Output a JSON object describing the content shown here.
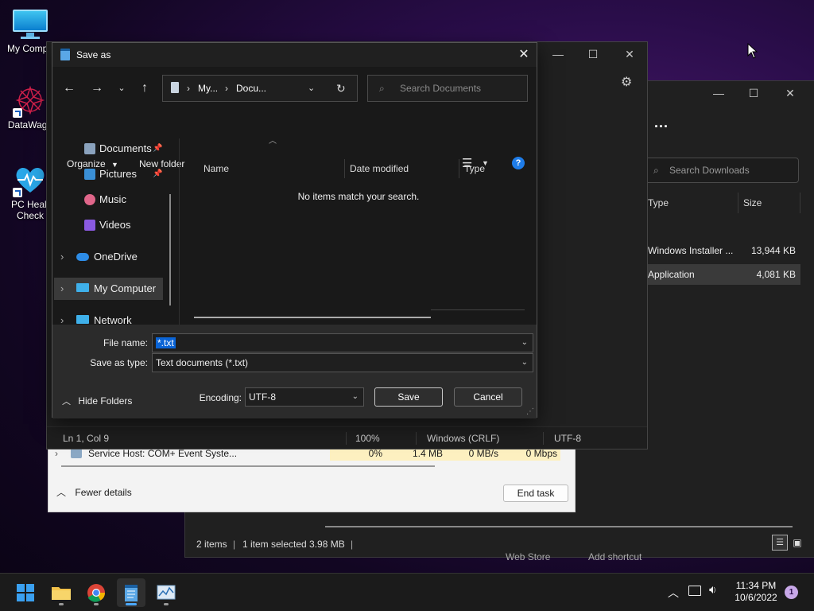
{
  "desktop": {
    "icons": [
      {
        "label": "My Compu"
      },
      {
        "label": "DataWago"
      },
      {
        "label": "PC Healt Check"
      }
    ]
  },
  "explorer": {
    "search_placeholder": "Search Downloads",
    "more": "...",
    "columns": [
      "Type",
      "Size"
    ],
    "rows": [
      {
        "type": "Windows Installer ...",
        "size": "13,944 KB"
      },
      {
        "type": "Application",
        "size": "4,081 KB"
      }
    ],
    "status": {
      "items": "2 items",
      "sep": "|",
      "selected": "1 item selected  3.98 MB"
    },
    "behind_text": [
      "Web Store",
      "Add shortcut"
    ]
  },
  "taskmgr": {
    "row_label": "Service Host: COM+ Event Syste...",
    "row_values": [
      "0%",
      "1.4 MB",
      "0 MB/s",
      "0 Mbps"
    ],
    "fewer_details": "Fewer details",
    "end_task": "End task"
  },
  "notepad": {
    "status": {
      "position": "Ln 1, Col 9",
      "zoom": "100%",
      "eol": "Windows (CRLF)",
      "encoding": "UTF-8"
    }
  },
  "saveas": {
    "title": "Save as",
    "address": {
      "part1": "My...",
      "part2": "Docu..."
    },
    "search_placeholder": "Search Documents",
    "toolbar": {
      "organize": "Organize",
      "new_folder": "New folder"
    },
    "tree": [
      {
        "label": "Documents",
        "pinned": true
      },
      {
        "label": "Pictures",
        "pinned": true
      },
      {
        "label": "Music",
        "pinned": false
      },
      {
        "label": "Videos",
        "pinned": false
      },
      {
        "label": "OneDrive"
      },
      {
        "label": "My Computer"
      },
      {
        "label": "Network"
      }
    ],
    "columns": [
      "Name",
      "Date modified",
      "Type"
    ],
    "empty_message": "No items match your search.",
    "file_name_label": "File name:",
    "file_name_value": "*.txt",
    "save_as_type_label": "Save as type:",
    "save_as_type_value": "Text documents (*.txt)",
    "hide_folders": "Hide Folders",
    "encoding_label": "Encoding:",
    "encoding_value": "UTF-8",
    "save_button": "Save",
    "cancel_button": "Cancel"
  },
  "taskbar": {
    "clock_time": "11:34 PM",
    "clock_date": "10/6/2022",
    "notification_count": "1"
  },
  "colors": {
    "accent": "#0067c0",
    "selection": "#0a64d6",
    "help_blue": "#1e7ce8"
  }
}
